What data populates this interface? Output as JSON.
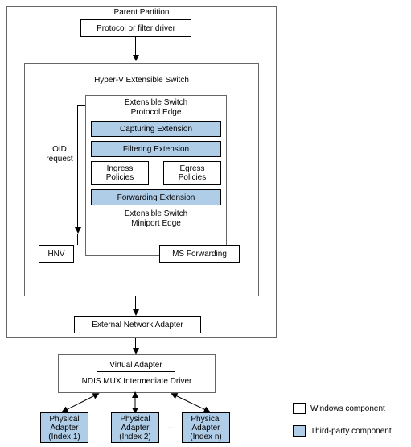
{
  "parent_partition": "Parent Partition",
  "protocol_driver": "Protocol or filter driver",
  "hyperv_switch": "Hyper-V Extensible Switch",
  "protocol_edge": "Extensible Switch\nProtocol Edge",
  "capturing": "Capturing Extension",
  "filtering": "Filtering Extension",
  "ingress": "Ingress\nPolicies",
  "egress": "Egress\nPolicies",
  "forwarding_ext": "Forwarding Extension",
  "miniport_edge": "Extensible Switch\nMiniport Edge",
  "oid_request": "OID\nrequest",
  "hnv": "HNV",
  "ms_forwarding": "MS Forwarding",
  "external_adapter": "External Network Adapter",
  "virtual_adapter": "Virtual Adapter",
  "ndis_mux": "NDIS MUX Intermediate Driver",
  "phys1": "Physical\nAdapter\n(Index 1)",
  "phys2": "Physical\nAdapter\n(Index 2)",
  "physn": "Physical\nAdapter\n(Index n)",
  "legend_windows": "Windows component",
  "legend_thirdparty": "Third-party component",
  "colors": {
    "blue": "#b0cde8"
  }
}
